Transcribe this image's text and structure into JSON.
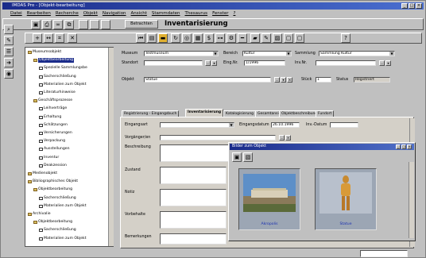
{
  "app": {
    "title": "IMDAS Pro - [Objekt-bearbeitung]"
  },
  "menu": [
    "Datei",
    "Bearbeiten",
    "Recherche",
    "Objekt",
    "Navigation",
    "Ansicht",
    "Stammdaten",
    "Thesaurus",
    "Fenster",
    "?"
  ],
  "form": {
    "tab_left": "Betrachten",
    "heading": "Inventarisierung",
    "museum_label": "Museum",
    "museum_value": "Testmuseum",
    "bereich_label": "Bereich",
    "bereich_value": "Kultur",
    "sammlung_label": "Sammlung",
    "sammlung_value": "Sammlung Kultur",
    "standort_label": "Standort",
    "eingnr_label": "Eing.Nr.",
    "eingnr_value": "1/1996",
    "invnr_label": "Inv.Nr.",
    "objekt_label": "Objekt",
    "objekt_value": "Statue",
    "stueck_label": "Stück",
    "stueck_value": "1",
    "status_label": "Status",
    "status_value": "Registriert",
    "eingangsart_label": "Eingangsart",
    "eingangsdatum_label": "Eingangsdatum",
    "eingangsdatum_value": "26.10.1996",
    "invdatum_label": "Inv.-Datum",
    "vorgaenger_label": "Vorgänger/en",
    "beschreibung_label": "Beschreibung",
    "zustand_label": "Zustand",
    "notiz_label": "Notiz",
    "vorbehalte_label": "Vorbehalte",
    "bemerkungen_label": "Bemerkungen"
  },
  "tabs": [
    "Registrierung - Eingangsbuch",
    "Inventarisierung",
    "Katalogisierung",
    "Gesamtansicht",
    "Objektbeschreibung",
    "Fundort"
  ],
  "tree": [
    {
      "label": "Museumsobjekt",
      "level": 0,
      "icon": "folder"
    },
    {
      "label": "Objektbearbeitung",
      "level": 1,
      "icon": "folder",
      "selected": true
    },
    {
      "label": "Spezielle Sammlungsbe",
      "level": 2,
      "icon": "doc"
    },
    {
      "label": "Sacherschließung",
      "level": 2,
      "icon": "doc"
    },
    {
      "label": "Materialien zum Objekt",
      "level": 2,
      "icon": "doc"
    },
    {
      "label": "Literaturhinweise",
      "level": 2,
      "icon": "doc"
    },
    {
      "label": "Geschäftsprozesse",
      "level": 1,
      "icon": "folder"
    },
    {
      "label": "Leihverträge",
      "level": 2,
      "icon": "doc"
    },
    {
      "label": "Erhaltung",
      "level": 2,
      "icon": "doc"
    },
    {
      "label": "Schätzungen",
      "level": 2,
      "icon": "doc"
    },
    {
      "label": "Versicherungen",
      "level": 2,
      "icon": "doc"
    },
    {
      "label": "Verpackung",
      "level": 2,
      "icon": "doc"
    },
    {
      "label": "Ausstellungen",
      "level": 2,
      "icon": "doc"
    },
    {
      "label": "Inventur",
      "level": 2,
      "icon": "doc"
    },
    {
      "label": "Deakzession",
      "level": 2,
      "icon": "doc"
    },
    {
      "label": "Medienobjekt",
      "level": 0,
      "icon": "folder"
    },
    {
      "label": "Bibliographisches Objekt",
      "level": 0,
      "icon": "folder"
    },
    {
      "label": "Objektbearbeitung",
      "level": 1,
      "icon": "folder"
    },
    {
      "label": "Sacherschließung",
      "level": 2,
      "icon": "doc"
    },
    {
      "label": "Materialien zum Objekt",
      "level": 2,
      "icon": "doc"
    },
    {
      "label": "Archivalie",
      "level": 0,
      "icon": "folder"
    },
    {
      "label": "Objektbearbeitung",
      "level": 1,
      "icon": "folder"
    },
    {
      "label": "Sacherschließung",
      "level": 2,
      "icon": "doc"
    },
    {
      "label": "Materialien zum Objekt",
      "level": 2,
      "icon": "doc"
    }
  ],
  "popup": {
    "title": "Bilder zum Objekt",
    "images": [
      {
        "caption": "Akropolis"
      },
      {
        "caption": "Statue"
      }
    ]
  },
  "colors": {
    "titlebar": "#1a2b8a",
    "window": "#c0c0c0",
    "link": "#1a30b0"
  }
}
